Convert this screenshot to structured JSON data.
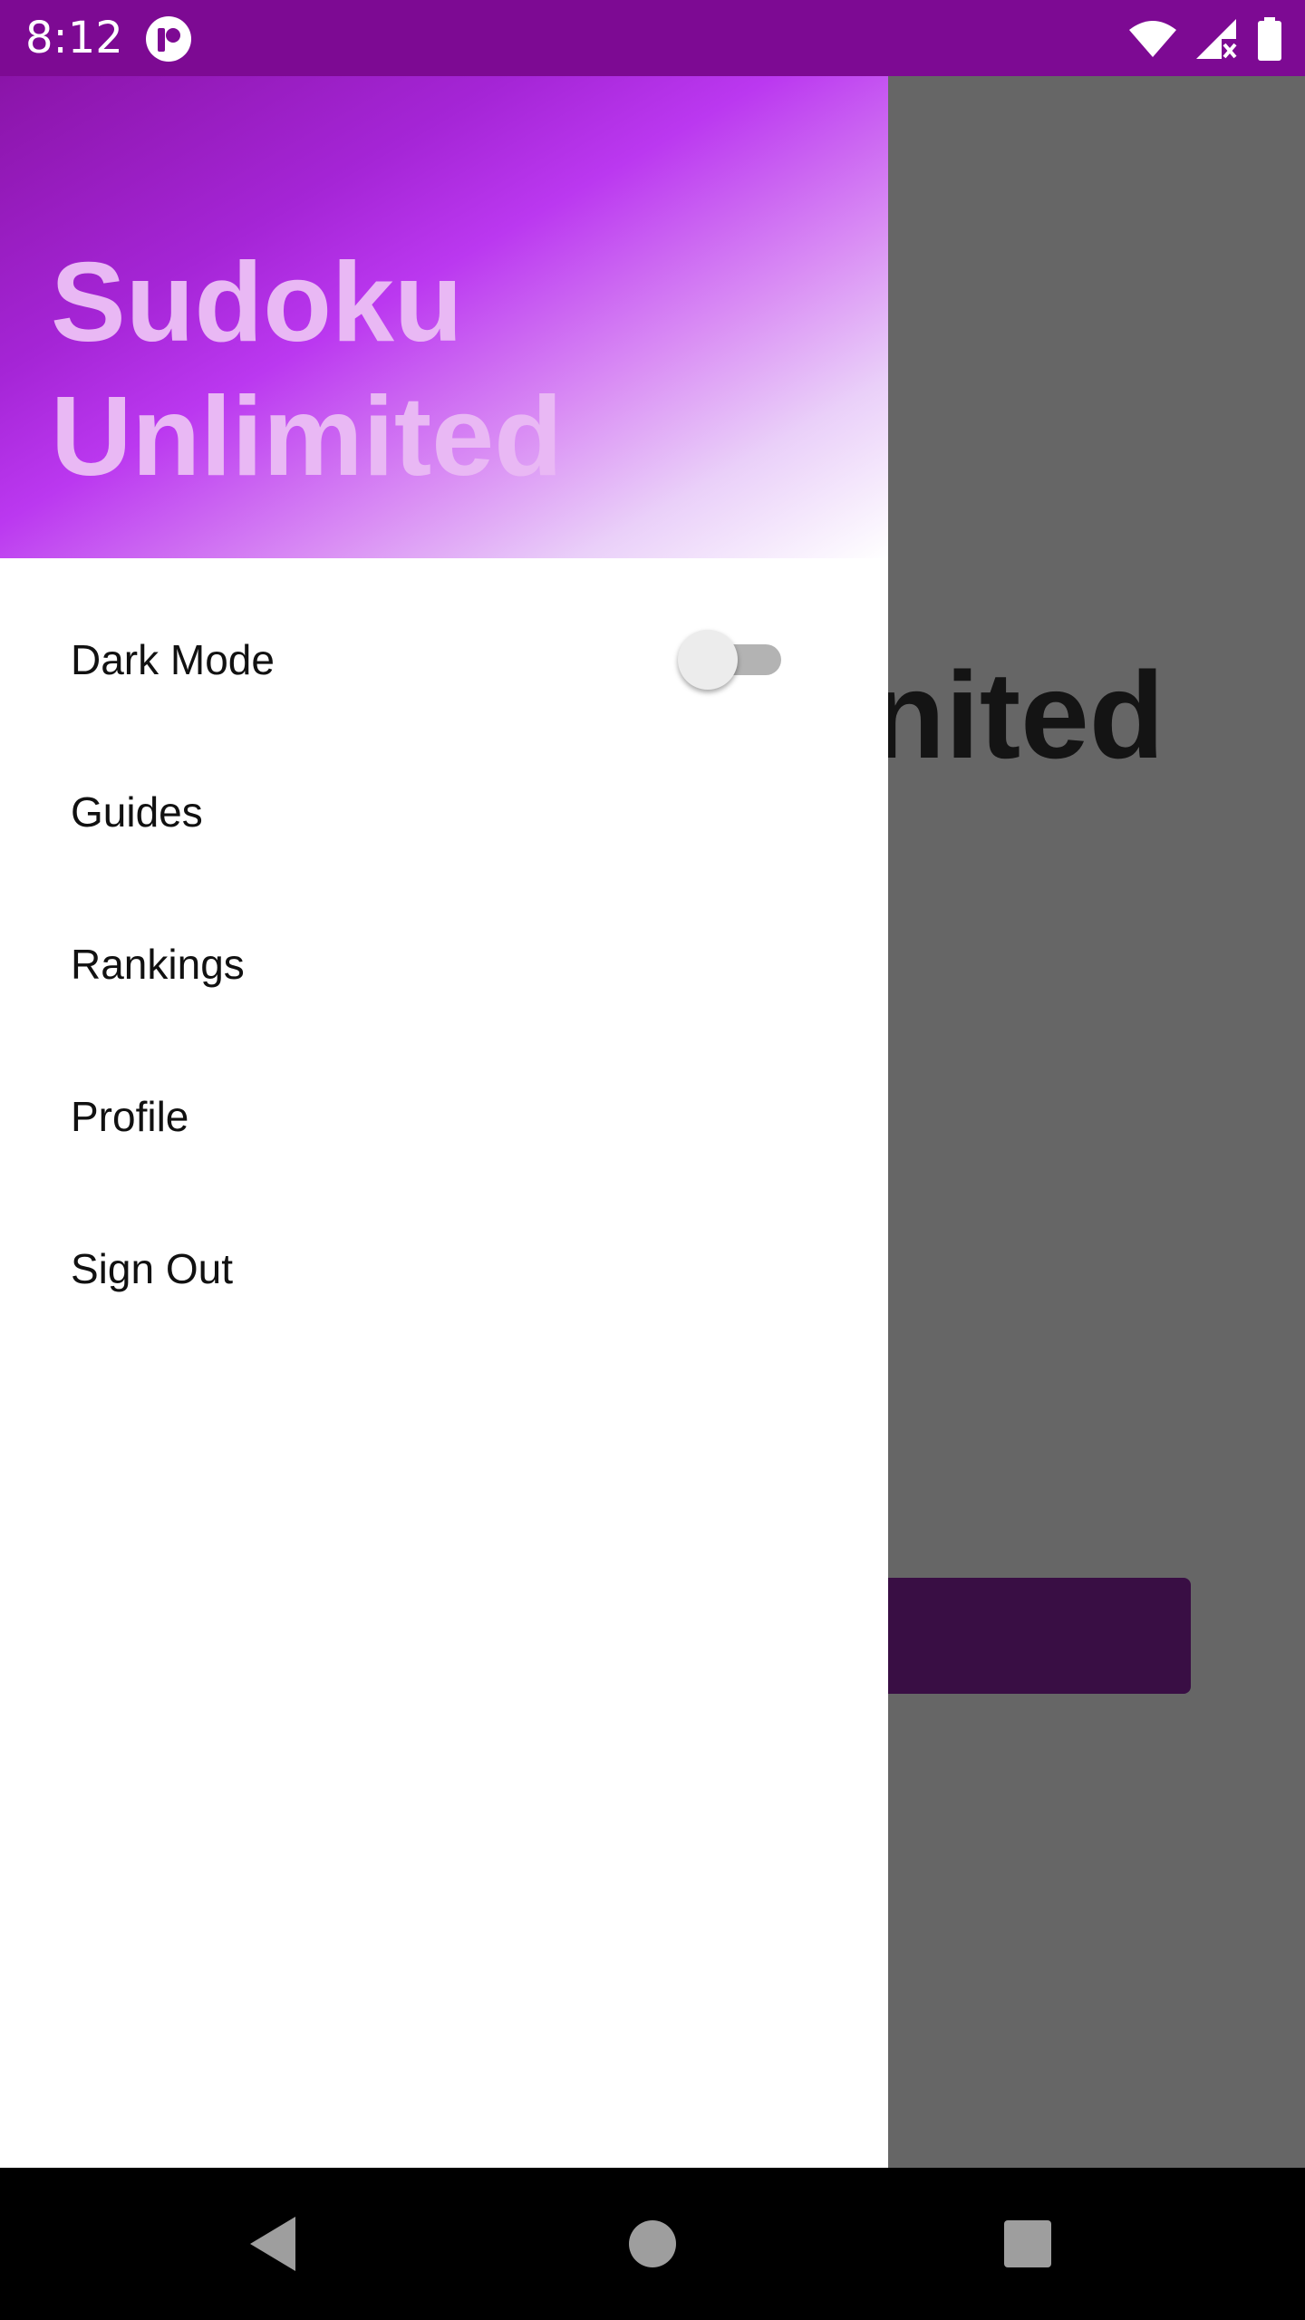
{
  "status_bar": {
    "time": "8:12",
    "app_icon": "app-notification-icon",
    "icons": [
      "wifi-icon",
      "signal-no-data-icon",
      "battery-icon"
    ],
    "background_color": "#7d0a93"
  },
  "background_app": {
    "title_fragment": "nited"
  },
  "drawer": {
    "header_title": "Sudoku Unlimited",
    "header_title_color": "#e9b8f4",
    "items": [
      {
        "label": "Dark Mode",
        "has_switch": true,
        "switch_on": false
      },
      {
        "label": "Guides"
      },
      {
        "label": "Rankings"
      },
      {
        "label": "Profile"
      },
      {
        "label": "Sign Out"
      }
    ]
  },
  "nav_bar": {
    "buttons": [
      "back-icon",
      "home-icon",
      "recents-icon"
    ]
  }
}
